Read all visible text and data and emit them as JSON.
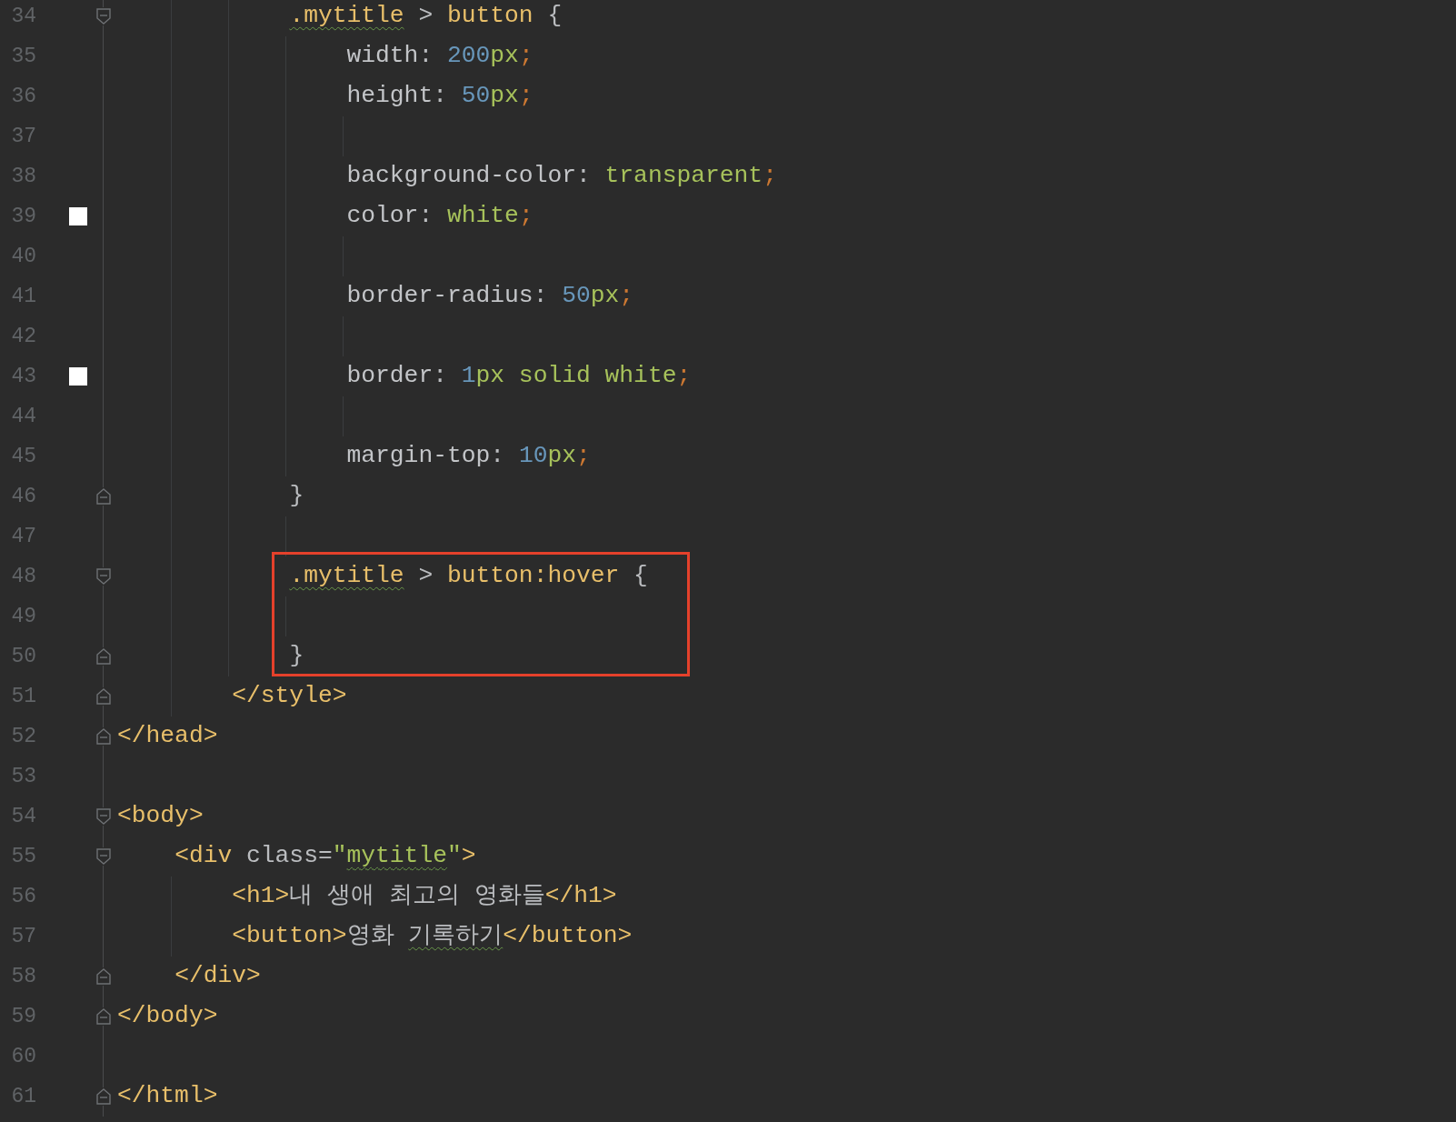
{
  "editor": {
    "lines": [
      {
        "number": "34",
        "fold": {
          "kind": "start"
        },
        "tokens": [
          {
            "kind": "selector",
            "text": "            .mytitle",
            "typo": true
          },
          {
            "kind": "plain",
            "text": " > "
          },
          {
            "kind": "tag",
            "text": "button"
          },
          {
            "kind": "plain",
            "text": " {"
          }
        ]
      },
      {
        "number": "35",
        "tokens": [
          {
            "kind": "property",
            "text": "                width"
          },
          {
            "kind": "plain",
            "text": ": "
          },
          {
            "kind": "number",
            "text": "200"
          },
          {
            "kind": "value",
            "text": "px"
          },
          {
            "kind": "semi",
            "text": ";"
          }
        ]
      },
      {
        "number": "36",
        "tokens": [
          {
            "kind": "property",
            "text": "                height"
          },
          {
            "kind": "plain",
            "text": ": "
          },
          {
            "kind": "number",
            "text": "50"
          },
          {
            "kind": "value",
            "text": "px"
          },
          {
            "kind": "semi",
            "text": ";"
          }
        ]
      },
      {
        "number": "37"
      },
      {
        "number": "38",
        "tokens": [
          {
            "kind": "property",
            "text": "                background-color"
          },
          {
            "kind": "plain",
            "text": ": "
          },
          {
            "kind": "value",
            "text": "transparent"
          },
          {
            "kind": "semi",
            "text": ";"
          }
        ]
      },
      {
        "number": "39",
        "swatch": {
          "color": "#ffffff"
        },
        "tokens": [
          {
            "kind": "property",
            "text": "                color"
          },
          {
            "kind": "plain",
            "text": ": "
          },
          {
            "kind": "value",
            "text": "white"
          },
          {
            "kind": "semi",
            "text": ";"
          }
        ]
      },
      {
        "number": "40"
      },
      {
        "number": "41",
        "tokens": [
          {
            "kind": "property",
            "text": "                border-radius"
          },
          {
            "kind": "plain",
            "text": ": "
          },
          {
            "kind": "number",
            "text": "50"
          },
          {
            "kind": "value",
            "text": "px"
          },
          {
            "kind": "semi",
            "text": ";"
          }
        ]
      },
      {
        "number": "42"
      },
      {
        "number": "43",
        "swatch": {
          "color": "#ffffff"
        },
        "tokens": [
          {
            "kind": "property",
            "text": "                border"
          },
          {
            "kind": "plain",
            "text": ": "
          },
          {
            "kind": "number",
            "text": "1"
          },
          {
            "kind": "value",
            "text": "px solid white"
          },
          {
            "kind": "semi",
            "text": ";"
          }
        ]
      },
      {
        "number": "44"
      },
      {
        "number": "45",
        "tokens": [
          {
            "kind": "property",
            "text": "                margin-top"
          },
          {
            "kind": "plain",
            "text": ": "
          },
          {
            "kind": "number",
            "text": "10"
          },
          {
            "kind": "value",
            "text": "px"
          },
          {
            "kind": "semi",
            "text": ";"
          }
        ]
      },
      {
        "number": "46",
        "fold": {
          "kind": "end"
        },
        "tokens": [
          {
            "kind": "plain",
            "text": "            }"
          }
        ]
      },
      {
        "number": "47"
      },
      {
        "number": "48",
        "fold": {
          "kind": "start"
        },
        "highlight": {
          "kind": "start"
        },
        "tokens": [
          {
            "kind": "selector",
            "text": "            .mytitle",
            "typo": true
          },
          {
            "kind": "plain",
            "text": " > "
          },
          {
            "kind": "tag",
            "text": "button:hover"
          },
          {
            "kind": "plain",
            "text": " {"
          }
        ]
      },
      {
        "number": "49"
      },
      {
        "number": "50",
        "fold": {
          "kind": "end"
        },
        "highlight": {
          "kind": "end"
        },
        "tokens": [
          {
            "kind": "plain",
            "text": "            }"
          }
        ]
      },
      {
        "number": "51",
        "fold": {
          "kind": "end"
        },
        "tokens": [
          {
            "kind": "tag",
            "text": "        </style>"
          }
        ]
      },
      {
        "number": "52",
        "fold": {
          "kind": "end"
        },
        "tokens": [
          {
            "kind": "tag",
            "text": "</head>"
          }
        ]
      },
      {
        "number": "53"
      },
      {
        "number": "54",
        "fold": {
          "kind": "start"
        },
        "tokens": [
          {
            "kind": "tag",
            "text": "<body>"
          }
        ]
      },
      {
        "number": "55",
        "fold": {
          "kind": "start"
        },
        "tokens": [
          {
            "kind": "tag",
            "text": "    <div"
          },
          {
            "kind": "plain",
            "text": " class="
          },
          {
            "kind": "string",
            "text": "\""
          },
          {
            "kind": "string",
            "text": "mytitle",
            "typo": true
          },
          {
            "kind": "string",
            "text": "\""
          },
          {
            "kind": "tag",
            "text": ">"
          }
        ]
      },
      {
        "number": "56",
        "tokens": [
          {
            "kind": "tag",
            "text": "        <h1>"
          },
          {
            "kind": "plain",
            "text": "내 생애 최고의 영화들"
          },
          {
            "kind": "tag",
            "text": "</h1>"
          }
        ]
      },
      {
        "number": "57",
        "tokens": [
          {
            "kind": "tag",
            "text": "        <button>"
          },
          {
            "kind": "plain",
            "text": "영화 "
          },
          {
            "kind": "plain",
            "text": "기록하기",
            "typo": true
          },
          {
            "kind": "tag",
            "text": "</button>"
          }
        ]
      },
      {
        "number": "58",
        "fold": {
          "kind": "end"
        },
        "tokens": [
          {
            "kind": "tag",
            "text": "    </div>"
          }
        ]
      },
      {
        "number": "59",
        "fold": {
          "kind": "end"
        },
        "tokens": [
          {
            "kind": "tag",
            "text": "</body>"
          }
        ]
      },
      {
        "number": "60"
      },
      {
        "number": "61",
        "fold": {
          "kind": "end"
        },
        "tokens": [
          {
            "kind": "tag",
            "text": "</html>"
          }
        ]
      }
    ]
  }
}
